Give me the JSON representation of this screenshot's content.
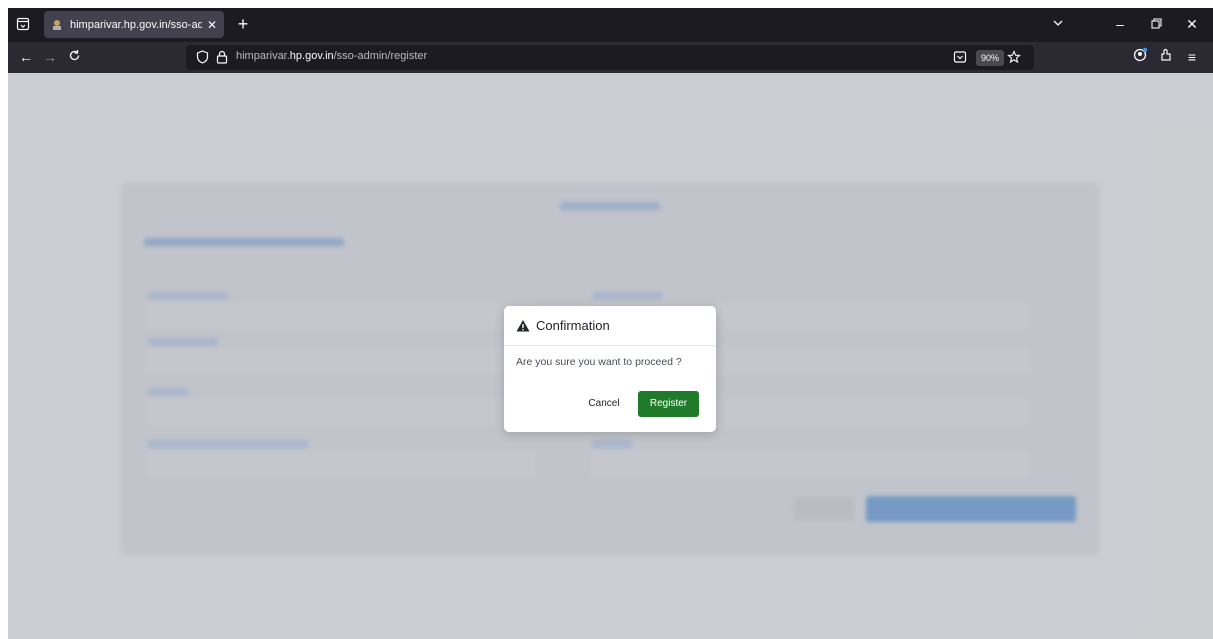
{
  "browser": {
    "tab": {
      "title": "himparivar.hp.gov.in/sso-admin"
    },
    "new_tab_icon": "plus-icon",
    "url": {
      "prefix": "himparivar.",
      "domain": "hp.gov.in",
      "path": "/sso-admin/register"
    },
    "zoom": "90%"
  },
  "dialog": {
    "title": "Confirmation",
    "message": "Are you sure you want to proceed ?",
    "cancel_label": "Cancel",
    "register_label": "Register",
    "register_color": "#1f7a2a"
  }
}
